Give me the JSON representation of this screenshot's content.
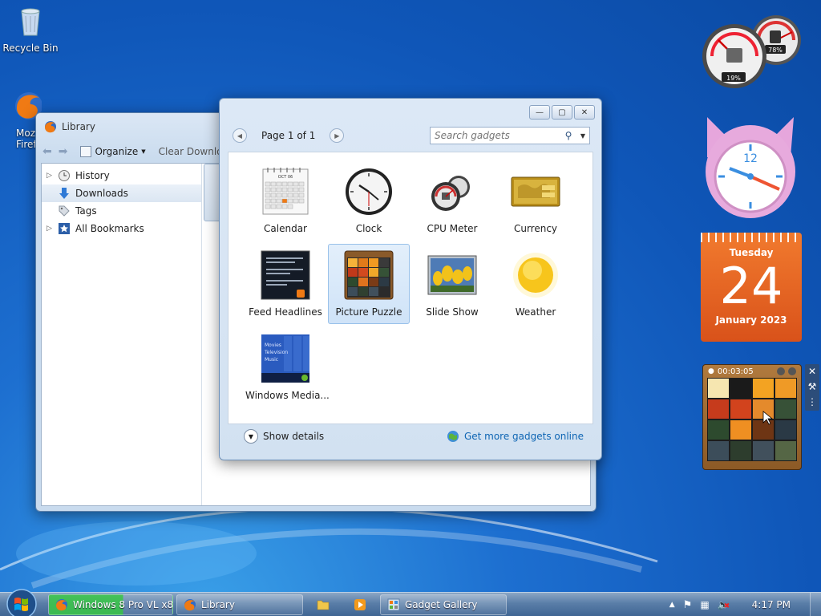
{
  "desktop": {
    "icons": [
      {
        "label": "Recycle Bin",
        "icon": "recycle-bin-icon"
      },
      {
        "label": "Moz\nFiref",
        "icon": "firefox-icon"
      }
    ]
  },
  "library": {
    "title": "Library",
    "toolbar": {
      "organize_label": "Organize",
      "clear_label": "Clear Downlo"
    },
    "nav": [
      {
        "label": "History",
        "icon": "clock-icon",
        "expandable": true
      },
      {
        "label": "Downloads",
        "icon": "download-arrow-icon",
        "expandable": false,
        "selected": true
      },
      {
        "label": "Tags",
        "icon": "tag-icon",
        "expandable": false
      },
      {
        "label": "All Bookmarks",
        "icon": "bookmark-star-icon",
        "expandable": true
      }
    ]
  },
  "gallery": {
    "pager_text": "Page 1 of 1",
    "search_placeholder": "Search gadgets",
    "gadgets": [
      {
        "label": "Calendar",
        "icon": "calendar-icon"
      },
      {
        "label": "Clock",
        "icon": "clock-icon"
      },
      {
        "label": "CPU Meter",
        "icon": "cpu-meter-icon"
      },
      {
        "label": "Currency",
        "icon": "currency-icon"
      },
      {
        "label": "Feed Headlines",
        "icon": "feed-headlines-icon"
      },
      {
        "label": "Picture Puzzle",
        "icon": "picture-puzzle-icon",
        "selected": true
      },
      {
        "label": "Slide Show",
        "icon": "slide-show-icon"
      },
      {
        "label": "Weather",
        "icon": "weather-sun-icon"
      },
      {
        "label": "Windows Media...",
        "icon": "windows-media-icon"
      }
    ],
    "calendar_thumb_month": "OCT 06",
    "media_thumb_lines": [
      "Movies",
      "Television",
      "Music"
    ],
    "show_details_label": "Show details",
    "get_more_label": "Get more gadgets online"
  },
  "sidebar_gadgets": {
    "cpu_meter": {
      "cpu_percent": "19%",
      "memory_percent": "78%",
      "cpu": 0.19,
      "memory": 0.78
    },
    "calendar": {
      "weekday": "Tuesday",
      "day": "24",
      "month_year": "January 2023"
    },
    "puzzle": {
      "timer": "00:03:05"
    }
  },
  "taskbar": {
    "tasks": [
      {
        "label": "Windows 8 Pro VL x8...",
        "icon": "firefox-icon",
        "progress": 0.6
      },
      {
        "label": "Library",
        "icon": "firefox-icon"
      },
      {
        "label": "",
        "icon": "folder-icon"
      },
      {
        "label": "",
        "icon": "media-player-icon"
      },
      {
        "label": "Gadget Gallery",
        "icon": "gadget-gallery-icon"
      }
    ],
    "clock": "4:17 PM"
  },
  "colors": {
    "desktop_blue": "#1d6fd0",
    "calendar_orange": "#e8621a",
    "link_blue": "#0f66b4"
  }
}
